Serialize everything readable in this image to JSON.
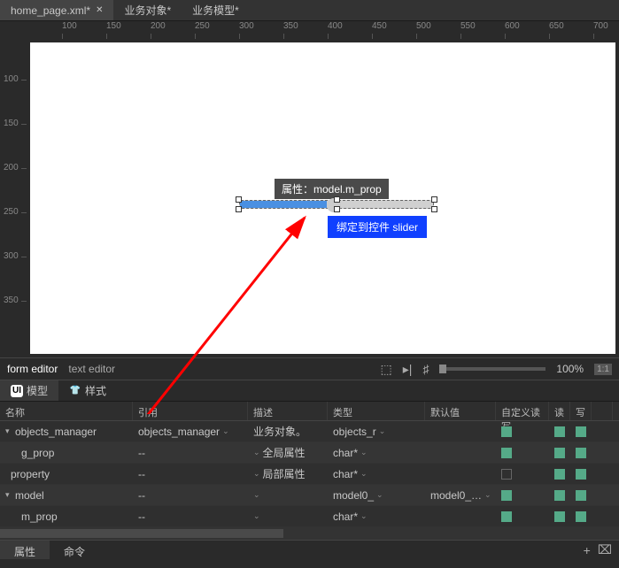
{
  "tabs": [
    {
      "label": "home_page.xml*",
      "active": true,
      "closable": true
    },
    {
      "label": "业务对象*",
      "active": false
    },
    {
      "label": "业务模型*",
      "active": false
    }
  ],
  "ruler_h": [
    100,
    150,
    200,
    250,
    300,
    350,
    400,
    450,
    500,
    550,
    600,
    650,
    700
  ],
  "ruler_v": [
    100,
    150,
    200,
    250,
    300,
    350
  ],
  "slider": {
    "tooltip_attr": "属性：model.m_prop",
    "tooltip_bind": "绑定到控件 slider"
  },
  "editor_bar": {
    "form": "form editor",
    "text": "text editor",
    "zoom": "100%",
    "ratio": "1:1"
  },
  "panel_tabs": [
    {
      "icon": "UI",
      "label": "模型",
      "active": true
    },
    {
      "icon": "shirt",
      "label": "样式",
      "active": false
    }
  ],
  "columns": [
    "名称",
    "引用",
    "描述",
    "类型",
    "默认值",
    "自定义读写",
    "读",
    "写",
    ""
  ],
  "rows": [
    {
      "indent": 0,
      "expand": "▾",
      "name": "objects_manager",
      "ref": "objects_manager",
      "desc": "业务对象。",
      "type": "objects_r",
      "def": "",
      "custom": true,
      "read": true,
      "write": true
    },
    {
      "indent": 1,
      "expand": "",
      "name": "g_prop",
      "ref": "--",
      "desc": "全局属性",
      "type": "char*",
      "def": "",
      "custom": true,
      "read": true,
      "write": true
    },
    {
      "indent": 0,
      "expand": "",
      "name": "property",
      "ref": "--",
      "desc": "局部属性",
      "type": "char*",
      "def": "",
      "custom": false,
      "read": true,
      "write": true
    },
    {
      "indent": 0,
      "expand": "▾",
      "name": "model",
      "ref": "--",
      "desc": "",
      "type": "model0_",
      "def": "model0_…",
      "custom": true,
      "read": true,
      "write": true
    },
    {
      "indent": 1,
      "expand": "",
      "name": "m_prop",
      "ref": "--",
      "desc": "",
      "type": "char*",
      "def": "",
      "custom": true,
      "read": true,
      "write": true
    }
  ],
  "footer": {
    "tabs": [
      {
        "label": "属性",
        "active": true
      },
      {
        "label": "命令",
        "active": false
      }
    ],
    "add": "+",
    "clear": "⌧"
  }
}
